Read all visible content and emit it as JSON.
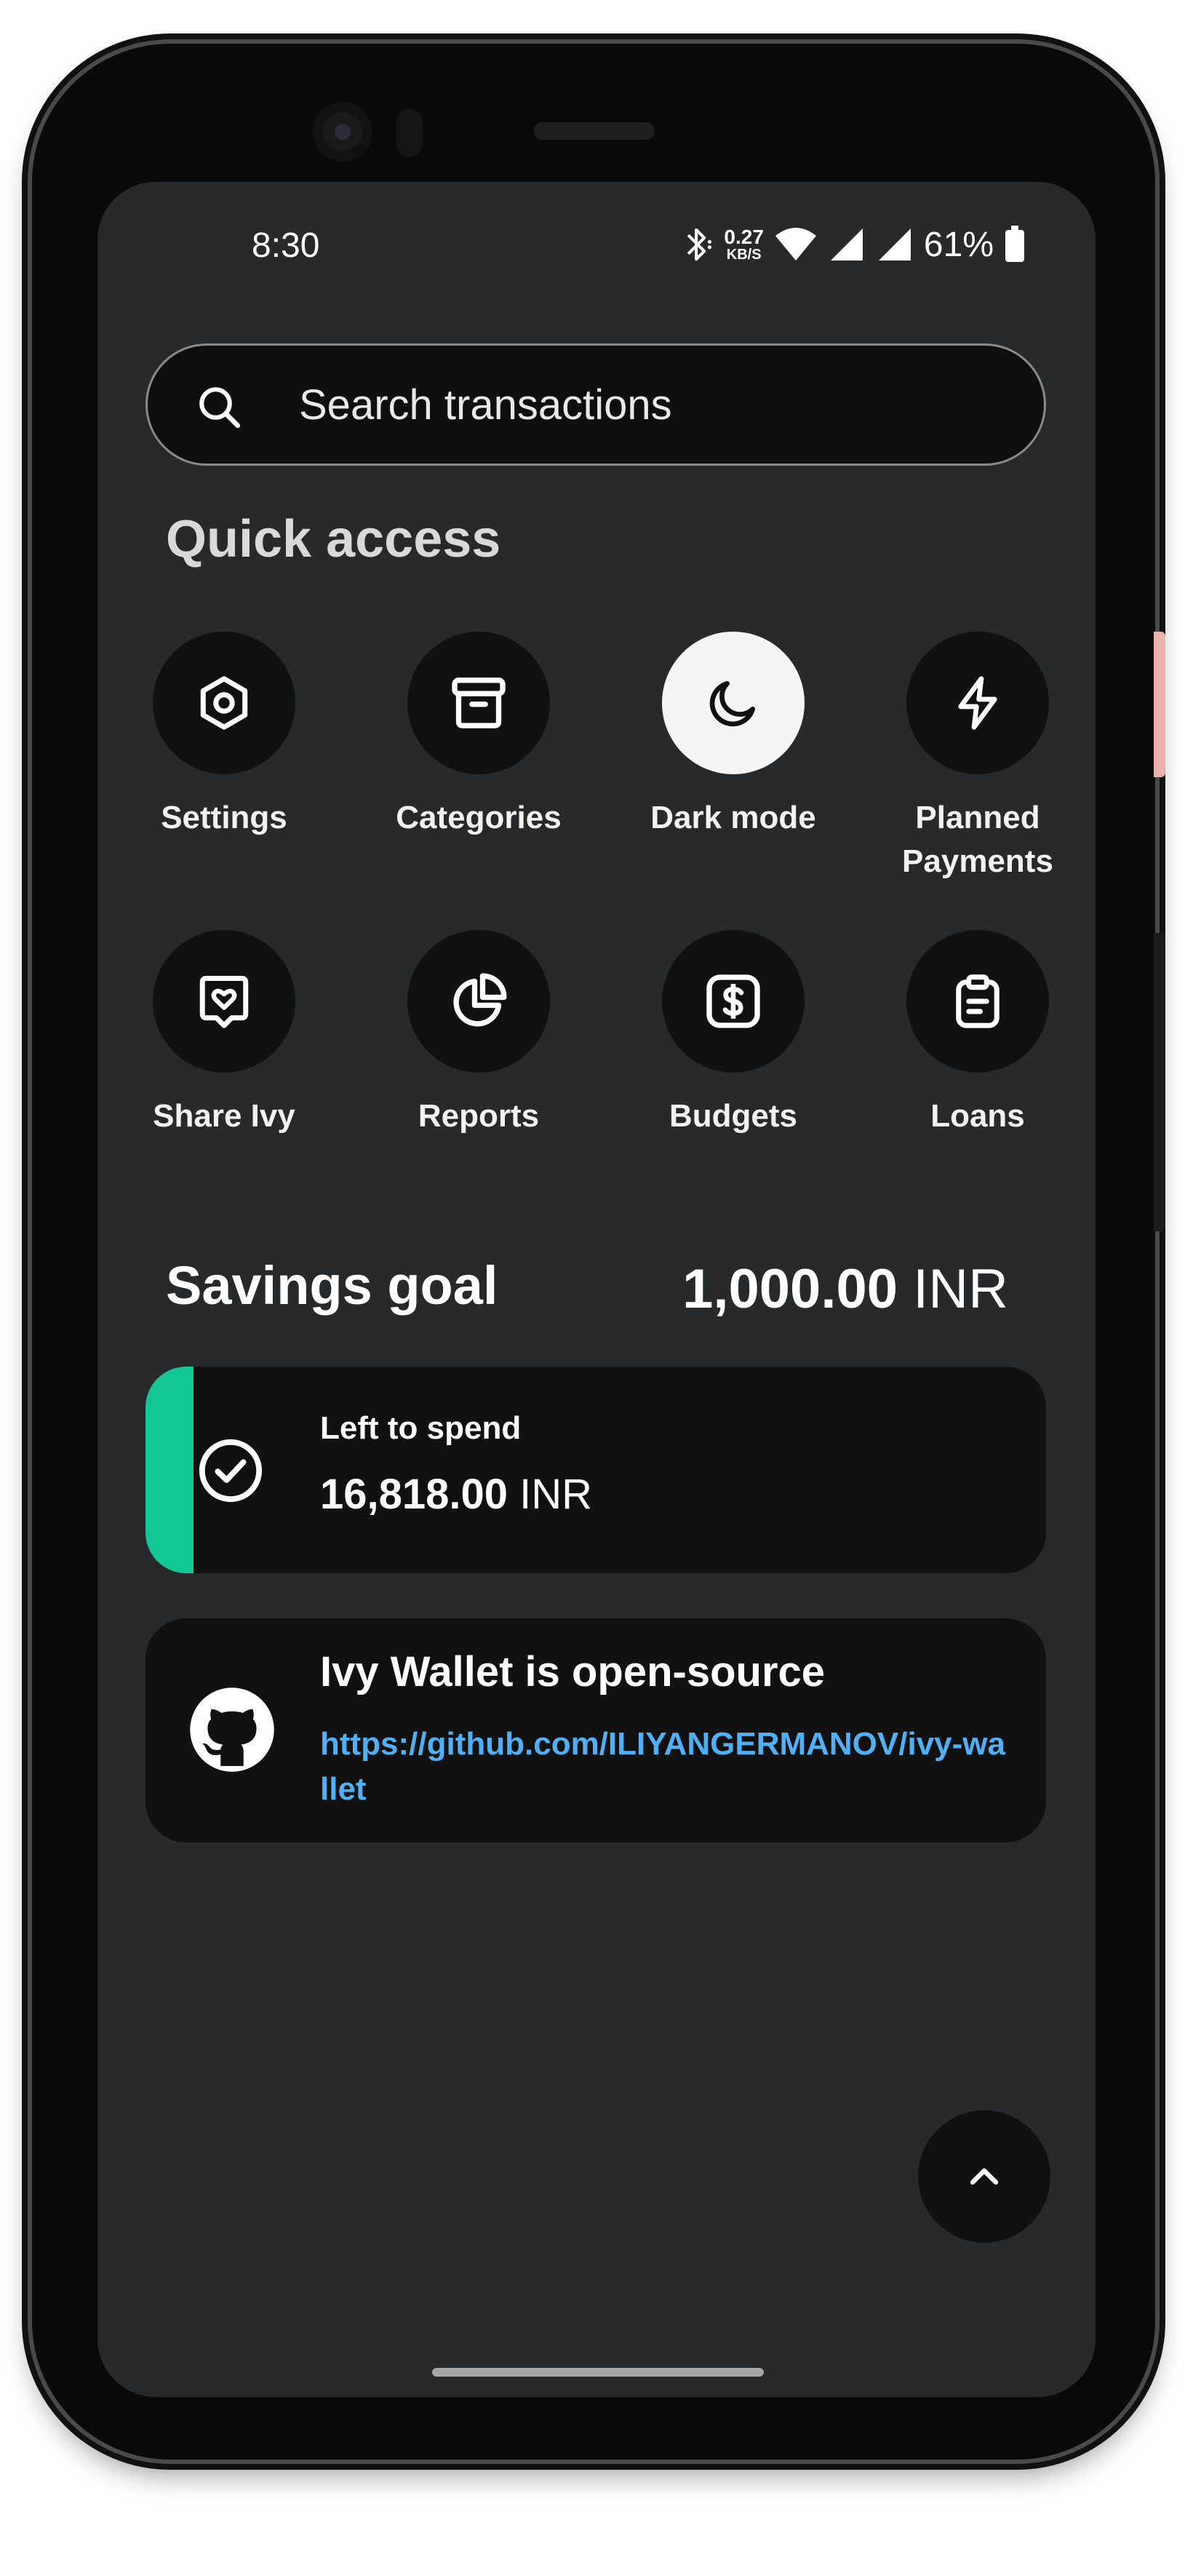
{
  "status_bar": {
    "time": "8:30",
    "net_speed_value": "0.27",
    "net_speed_unit": "KB/S",
    "battery": "61%"
  },
  "search": {
    "placeholder": "Search transactions",
    "icon": "search-icon"
  },
  "quick_access": {
    "title": "Quick access",
    "items": [
      {
        "label": "Settings",
        "icon": "settings-icon"
      },
      {
        "label": "Categories",
        "icon": "archive-icon"
      },
      {
        "label": "Dark mode",
        "icon": "moon-icon",
        "active": true
      },
      {
        "label": "Planned Payments",
        "icon": "bolt-icon"
      },
      {
        "label": "Share Ivy",
        "icon": "heart-chat-icon"
      },
      {
        "label": "Reports",
        "icon": "pie-chart-icon"
      },
      {
        "label": "Budgets",
        "icon": "dollar-icon"
      },
      {
        "label": "Loans",
        "icon": "clipboard-icon"
      }
    ]
  },
  "savings": {
    "title": "Savings goal",
    "amount": "1,000.00",
    "currency": "INR"
  },
  "left_to_spend": {
    "label": "Left to spend",
    "amount": "16,818.00",
    "currency": "INR",
    "accent_color": "#13c795"
  },
  "open_source": {
    "title": "Ivy Wallet is open-source",
    "link": "https://github.com/ILIYANGERMANOV/ivy-wallet",
    "link_color": "#4fb0f5"
  }
}
